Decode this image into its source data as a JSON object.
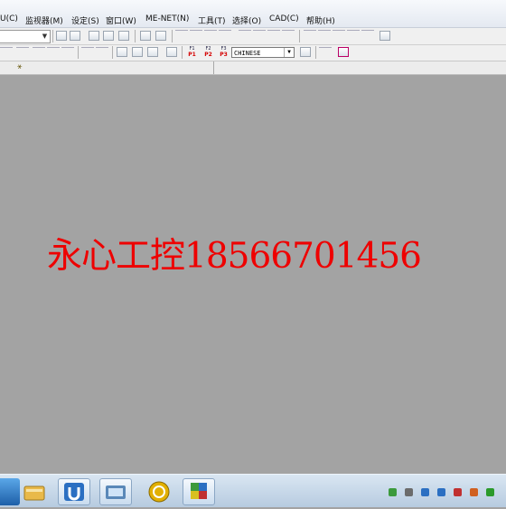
{
  "menu": {
    "items": [
      "U(C)",
      "监视器(M)",
      "设定(S)",
      "窗口(W)",
      "ME-NET(N)",
      "工具(T)",
      "选择(O)",
      "CAD(C)",
      "帮助(H)"
    ]
  },
  "toolbar": {
    "language_value": "CHINESE",
    "p_buttons": [
      {
        "key": "F1",
        "label": "P1"
      },
      {
        "key": "F2",
        "label": "P2"
      },
      {
        "key": "F3",
        "label": "P3"
      }
    ]
  },
  "watermark": {
    "text": "永心工控18566701456"
  },
  "taskbar": {
    "apps": [
      "file-explorer-icon",
      "ladder-app-icon",
      "pc-app-icon",
      "shell-app-icon",
      "game-app-icon"
    ]
  },
  "colors": {
    "watermark": "#ee0000",
    "workspace": "#a3a3a3"
  }
}
